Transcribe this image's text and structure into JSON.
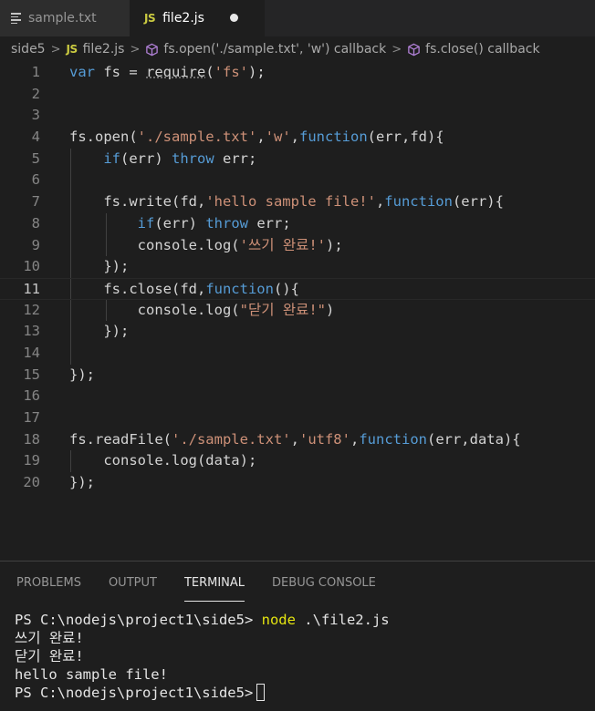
{
  "tabs": [
    {
      "label": "sample.txt",
      "icon": "lines-icon",
      "active": false
    },
    {
      "label": "file2.js",
      "icon": "js-icon",
      "icon_text": "JS",
      "active": true,
      "dirty": true
    }
  ],
  "breadcrumb": [
    {
      "label": "side5",
      "icon": null
    },
    {
      "label": "file2.js",
      "icon": "js-icon",
      "icon_text": "JS"
    },
    {
      "label": "fs.open('./sample.txt', 'w') callback",
      "icon": "cube-icon"
    },
    {
      "label": "fs.close() callback",
      "icon": "cube-icon"
    }
  ],
  "editor": {
    "current_line": 11,
    "lines": [
      {
        "n": "1",
        "indent": 0,
        "tokens": [
          [
            "k",
            "var"
          ],
          [
            "d",
            " fs = "
          ],
          [
            "dots",
            "require"
          ],
          [
            "d",
            "("
          ],
          [
            "s",
            "'fs'"
          ],
          [
            "d",
            ");"
          ]
        ]
      },
      {
        "n": "2",
        "indent": 0,
        "tokens": []
      },
      {
        "n": "3",
        "indent": 0,
        "tokens": []
      },
      {
        "n": "4",
        "indent": 0,
        "tokens": [
          [
            "d",
            "fs.open("
          ],
          [
            "s",
            "'./sample.txt'"
          ],
          [
            "d",
            ","
          ],
          [
            "s",
            "'w'"
          ],
          [
            "d",
            ","
          ],
          [
            "k",
            "function"
          ],
          [
            "d",
            "(err,fd){"
          ]
        ]
      },
      {
        "n": "5",
        "indent": 1,
        "tokens": [
          [
            "d",
            "    "
          ],
          [
            "k",
            "if"
          ],
          [
            "d",
            "(err) "
          ],
          [
            "k",
            "throw"
          ],
          [
            "d",
            " err;"
          ]
        ]
      },
      {
        "n": "6",
        "indent": 1,
        "tokens": []
      },
      {
        "n": "7",
        "indent": 1,
        "tokens": [
          [
            "d",
            "    fs.write(fd,"
          ],
          [
            "s",
            "'hello sample file!'"
          ],
          [
            "d",
            ","
          ],
          [
            "k",
            "function"
          ],
          [
            "d",
            "(err){"
          ]
        ]
      },
      {
        "n": "8",
        "indent": 2,
        "tokens": [
          [
            "d",
            "        "
          ],
          [
            "k",
            "if"
          ],
          [
            "d",
            "(err) "
          ],
          [
            "k",
            "throw"
          ],
          [
            "d",
            " err;"
          ]
        ]
      },
      {
        "n": "9",
        "indent": 2,
        "tokens": [
          [
            "d",
            "        console.log("
          ],
          [
            "s",
            "'쓰기 완료!'"
          ],
          [
            "d",
            ");"
          ]
        ]
      },
      {
        "n": "10",
        "indent": 1,
        "tokens": [
          [
            "d",
            "    });"
          ]
        ]
      },
      {
        "n": "11",
        "indent": 1,
        "tokens": [
          [
            "d",
            "    fs.close(fd,"
          ],
          [
            "k",
            "function"
          ],
          [
            "d",
            "(){"
          ]
        ]
      },
      {
        "n": "12",
        "indent": 2,
        "tokens": [
          [
            "d",
            "        console.log("
          ],
          [
            "s",
            "\"닫기 완료!\""
          ],
          [
            "d",
            ")"
          ]
        ]
      },
      {
        "n": "13",
        "indent": 1,
        "tokens": [
          [
            "d",
            "    });"
          ]
        ]
      },
      {
        "n": "14",
        "indent": 1,
        "tokens": []
      },
      {
        "n": "15",
        "indent": 0,
        "tokens": [
          [
            "d",
            "});"
          ]
        ]
      },
      {
        "n": "16",
        "indent": 0,
        "tokens": []
      },
      {
        "n": "17",
        "indent": 0,
        "tokens": []
      },
      {
        "n": "18",
        "indent": 0,
        "tokens": [
          [
            "d",
            "fs.readFile("
          ],
          [
            "s",
            "'./sample.txt'"
          ],
          [
            "d",
            ","
          ],
          [
            "s",
            "'utf8'"
          ],
          [
            "d",
            ","
          ],
          [
            "k",
            "function"
          ],
          [
            "d",
            "(err,data){"
          ]
        ]
      },
      {
        "n": "19",
        "indent": 1,
        "tokens": [
          [
            "d",
            "    console.log(data);"
          ]
        ]
      },
      {
        "n": "20",
        "indent": 0,
        "tokens": [
          [
            "d",
            "});"
          ]
        ]
      }
    ]
  },
  "panel": {
    "tabs": [
      {
        "label": "PROBLEMS",
        "active": false
      },
      {
        "label": "OUTPUT",
        "active": false
      },
      {
        "label": "TERMINAL",
        "active": true
      },
      {
        "label": "DEBUG CONSOLE",
        "active": false
      }
    ],
    "terminal": {
      "prompt1": "PS C:\\nodejs\\project1\\side5> ",
      "command": "node",
      "command_args": " .\\file2.js",
      "output": [
        "쓰기 완료!",
        "닫기 완료!",
        "hello sample file!"
      ],
      "prompt2": "PS C:\\nodejs\\project1\\side5>"
    }
  },
  "colors": {
    "keyword": "#569cd6",
    "string": "#ce9178",
    "default": "#d4d4d4",
    "command": "#e5e510",
    "js_icon": "#cbcb41",
    "cube_icon": "#b180d7"
  }
}
